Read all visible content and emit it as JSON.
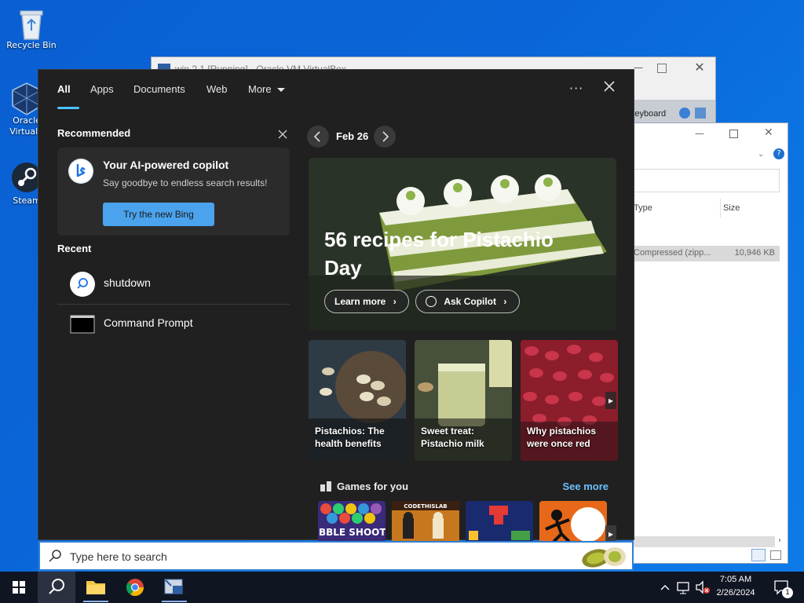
{
  "desktop": {
    "icons": [
      {
        "label": "Recycle Bin"
      },
      {
        "label": "Oracle\nVirtualB"
      },
      {
        "label": "Steam"
      }
    ]
  },
  "bg_windows": {
    "vbox_title": "win 2.1 [Running] - Oracle VM VirtualBox",
    "keyboard_label": "Keyboard",
    "explorer": {
      "col_type": "Type",
      "col_size": "Size",
      "row_type": "Compressed (zipp...",
      "row_size": "10,946 KB"
    }
  },
  "search_panel": {
    "tabs": [
      {
        "label": "All",
        "active": true
      },
      {
        "label": "Apps"
      },
      {
        "label": "Documents"
      },
      {
        "label": "Web"
      },
      {
        "label": "More"
      }
    ],
    "recommended": {
      "title": "Recommended",
      "card_title": "Your AI-powered copilot",
      "card_subtitle": "Say goodbye to endless search results!",
      "button": "Try the new Bing"
    },
    "recent": {
      "title": "Recent",
      "items": [
        {
          "label": "shutdown",
          "icon": "search-icon"
        },
        {
          "label": "Command Prompt",
          "icon": "command-prompt-icon"
        }
      ]
    },
    "date_nav": {
      "date": "Feb 26"
    },
    "hero": {
      "title": "56 recipes for Pistachio Day",
      "learn_more": "Learn more",
      "ask_copilot": "Ask Copilot"
    },
    "tiles": [
      {
        "caption": "Pistachios: The health benefits"
      },
      {
        "caption": "Sweet treat: Pistachio milk"
      },
      {
        "caption": "Why pistachios were once red"
      }
    ],
    "games": {
      "title": "Games for you",
      "see_more": "See more",
      "items": [
        {
          "name": "BUBBLE SHOOTER"
        },
        {
          "name": "CODETHISLAB"
        },
        {
          "name": "Blocks"
        },
        {
          "name": "Stickman"
        }
      ]
    }
  },
  "searchbox": {
    "placeholder": "Type here to search"
  },
  "taskbar": {
    "time": "7:05 AM",
    "date": "2/26/2024",
    "notification_count": "1"
  },
  "colors": {
    "accent": "#4cc2ff",
    "panel_bg": "#202020",
    "desktop_bg": "#0a66d8",
    "bing_button": "#4aa3ec",
    "taskbar_bg": "#101522"
  }
}
